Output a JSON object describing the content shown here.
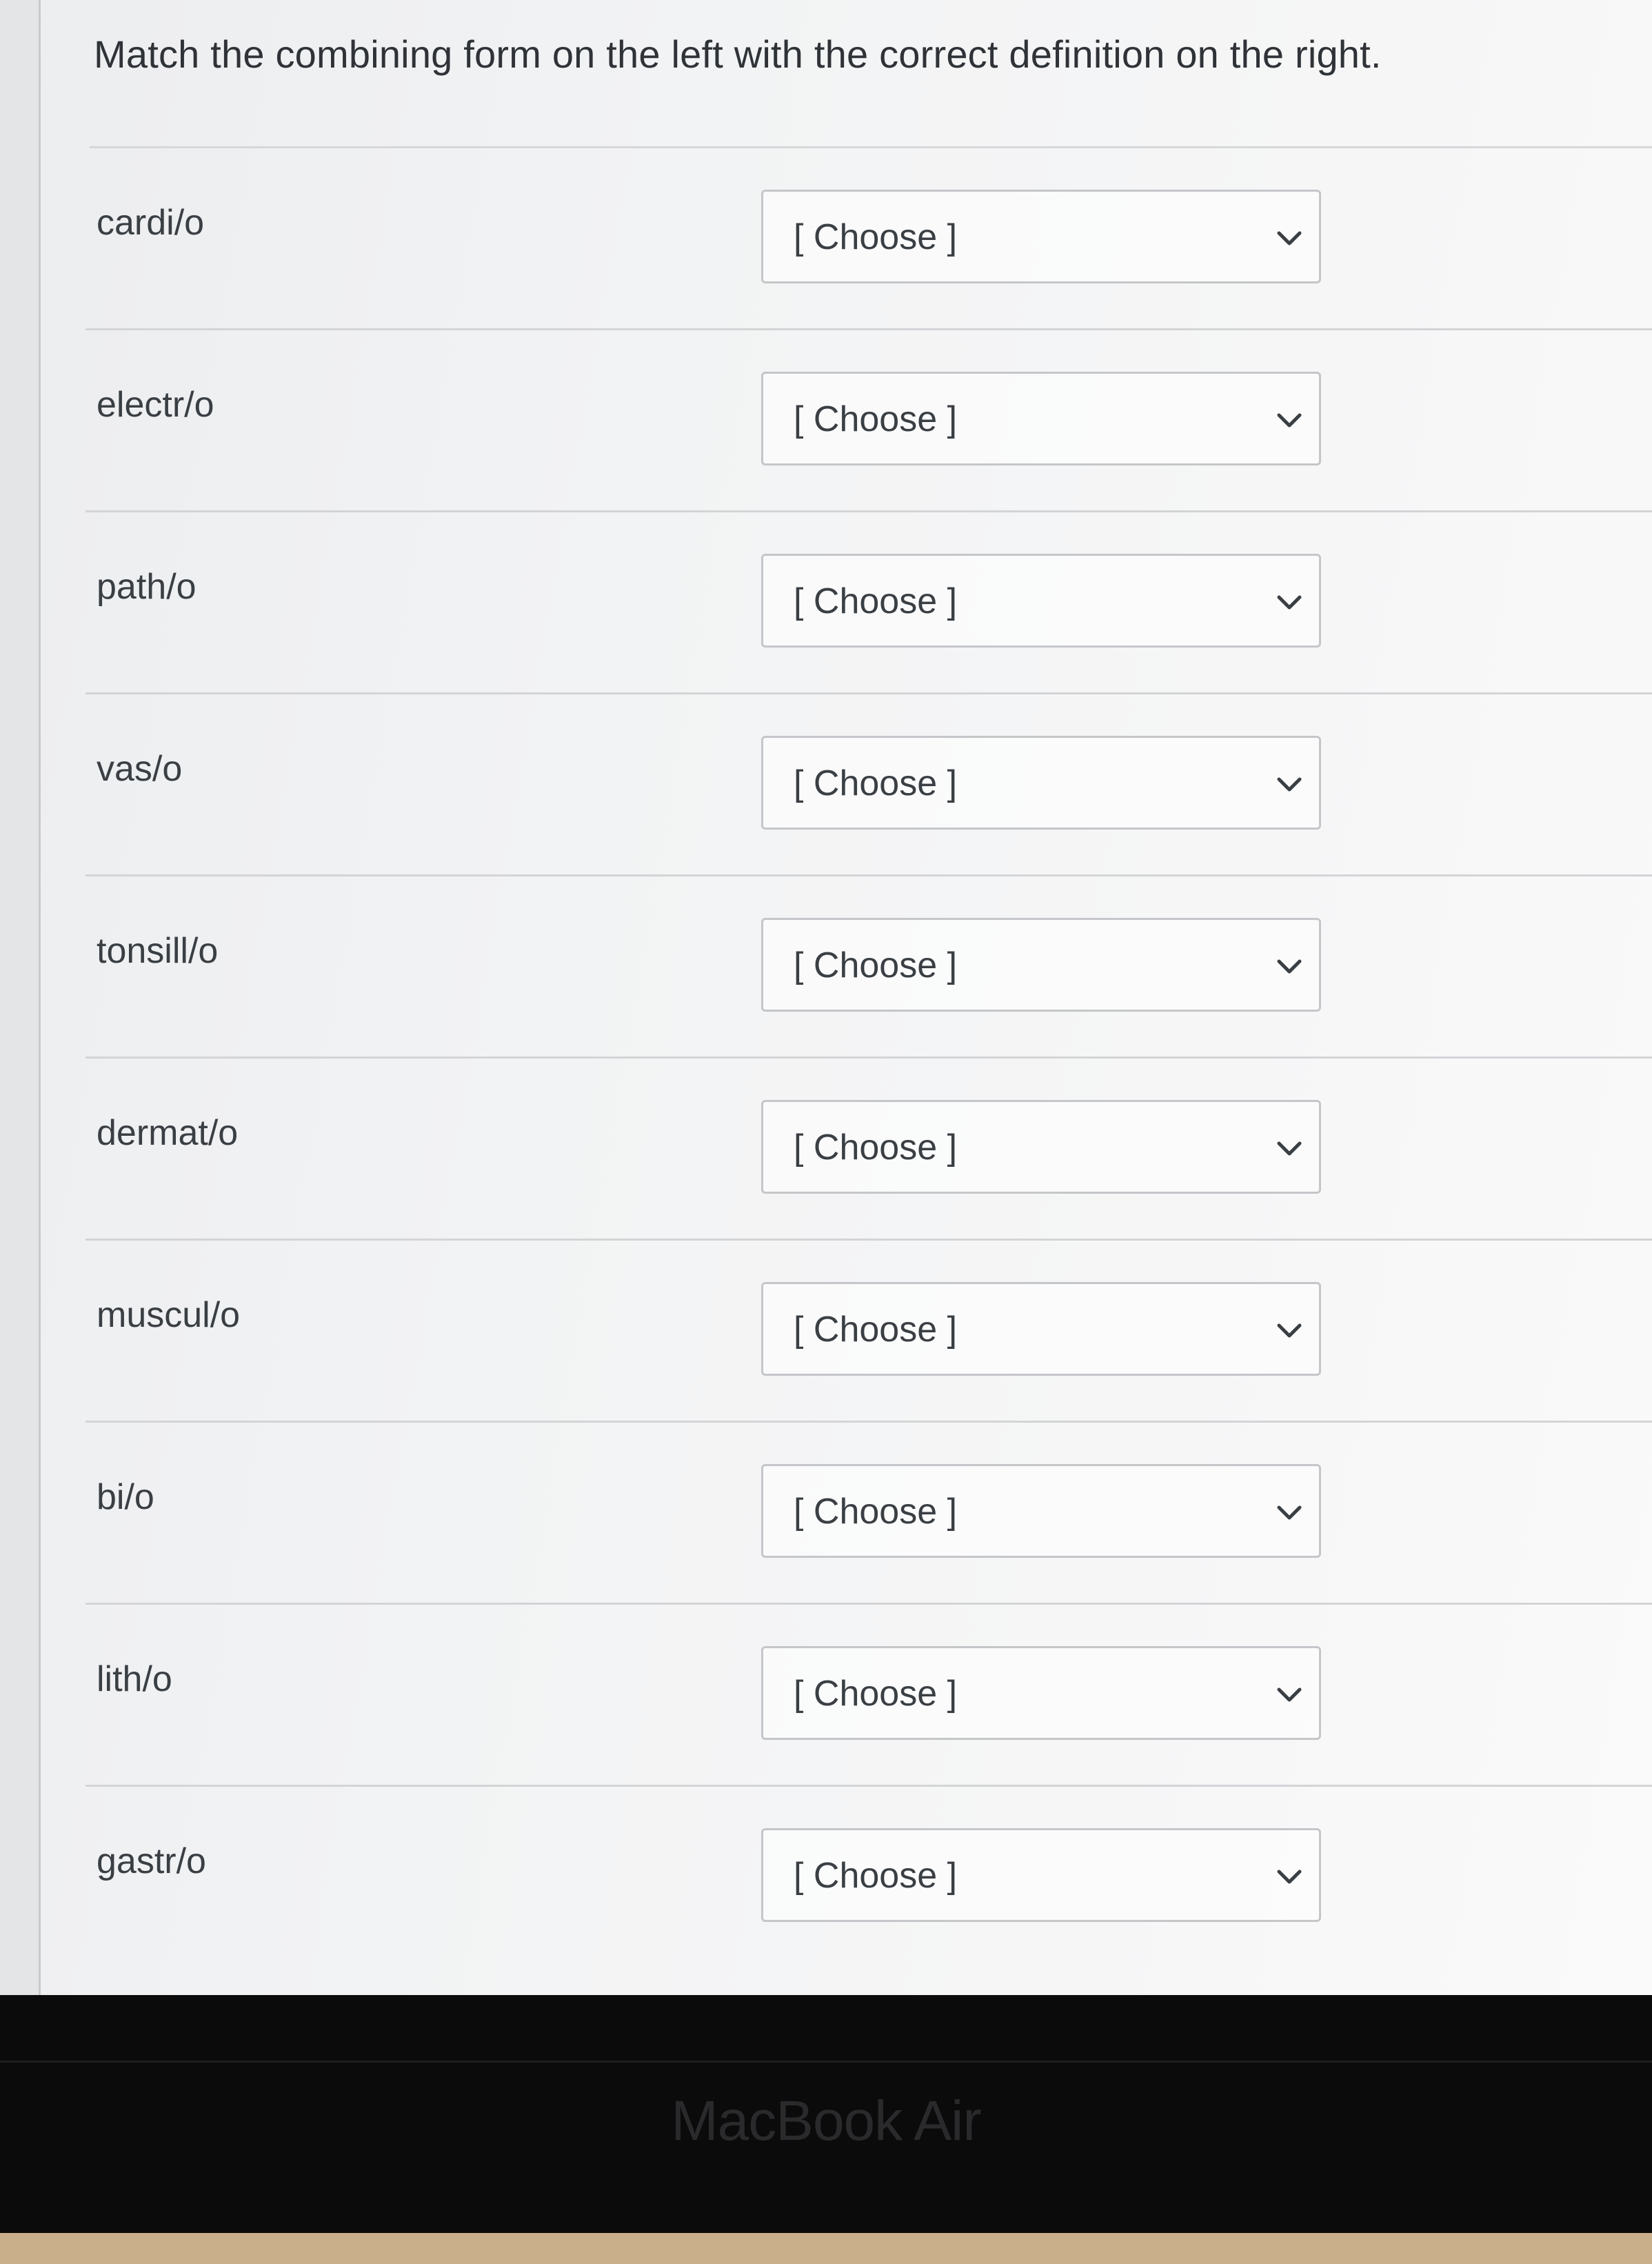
{
  "question": {
    "prompt": "Match the combining form on the left with the correct definition on the right."
  },
  "matches": [
    {
      "term": "cardi/o",
      "selected": "[ Choose ]"
    },
    {
      "term": "electr/o",
      "selected": "[ Choose ]"
    },
    {
      "term": "path/o",
      "selected": "[ Choose ]"
    },
    {
      "term": "vas/o",
      "selected": "[ Choose ]"
    },
    {
      "term": "tonsill/o",
      "selected": "[ Choose ]"
    },
    {
      "term": "dermat/o",
      "selected": "[ Choose ]"
    },
    {
      "term": "muscul/o",
      "selected": "[ Choose ]"
    },
    {
      "term": "bi/o",
      "selected": "[ Choose ]"
    },
    {
      "term": "lith/o",
      "selected": "[ Choose ]"
    },
    {
      "term": "gastr/o",
      "selected": "[ Choose ]"
    }
  ],
  "device": {
    "brand": "MacBook Air"
  },
  "icons": {
    "dropdown": "chevron-down-icon"
  },
  "colors": {
    "text": "#3a3f44",
    "border": "#c4c6c9",
    "bezel": "#0b0b0c"
  }
}
